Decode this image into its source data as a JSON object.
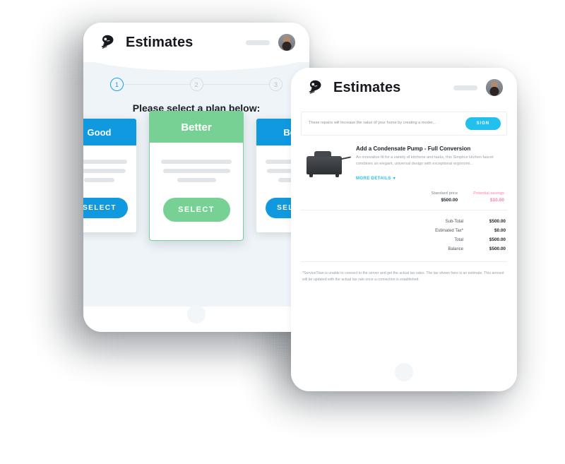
{
  "app": {
    "title": "Estimates",
    "logo_icon": "servicetitan-mascot-logo",
    "header_pill_placeholder": "",
    "avatar_icon": "user-avatar"
  },
  "tablet_one": {
    "stepper": {
      "steps": [
        {
          "number": "1",
          "state": "active"
        },
        {
          "number": "2",
          "state": "inactive"
        },
        {
          "number": "3",
          "state": "inactive"
        }
      ]
    },
    "prompt": "Please select a plan below:",
    "plans": [
      {
        "name": "Good",
        "accent": "#1199e0",
        "select_label": "SELECT",
        "featured": "false"
      },
      {
        "name": "Better",
        "accent": "#77d195",
        "select_label": "SELECT",
        "featured": "true"
      },
      {
        "name": "Best",
        "accent": "#1199e0",
        "select_label": "SELECT",
        "featured": "false"
      }
    ],
    "home_button_icon": "home-button"
  },
  "tablet_two": {
    "notice": {
      "text": "These repairs will increase the value of your home by creating a moder...",
      "sign_label": "SIGN",
      "sign_color": "#23c0ed"
    },
    "line_item": {
      "thumbnail_icon": "condensate-pump-image",
      "title": "Add a Condensate Pump - Full Conversion",
      "description": "An innovative fit for a variety of kitchens and tasks, this Simplice kitchen faucet combines an elegant, universal design with exceptional ergonomi...",
      "more_details_label": "MORE DETAILS",
      "more_details_icon": "chevron-down-icon",
      "standard_price_label": "Standard price",
      "standard_price_value": "$500.00",
      "savings_label": "Potential savings",
      "savings_value": "$10.00",
      "savings_color": "#ff7cae"
    },
    "totals": [
      {
        "label": "Sub-Total",
        "value": "$500.00"
      },
      {
        "label": "Estimated Tax*",
        "value": "$0.00"
      },
      {
        "label": "Total",
        "value": "$500.00"
      },
      {
        "label": "Balance",
        "value": "$500.00"
      }
    ],
    "footnote": "*ServiceTitan is unable to connect to the server and get the actual tax rates. The tax shown here is an estimate. This amount will be updated with the actual tax rate once a connection is established.",
    "home_button_icon": "home-button"
  }
}
